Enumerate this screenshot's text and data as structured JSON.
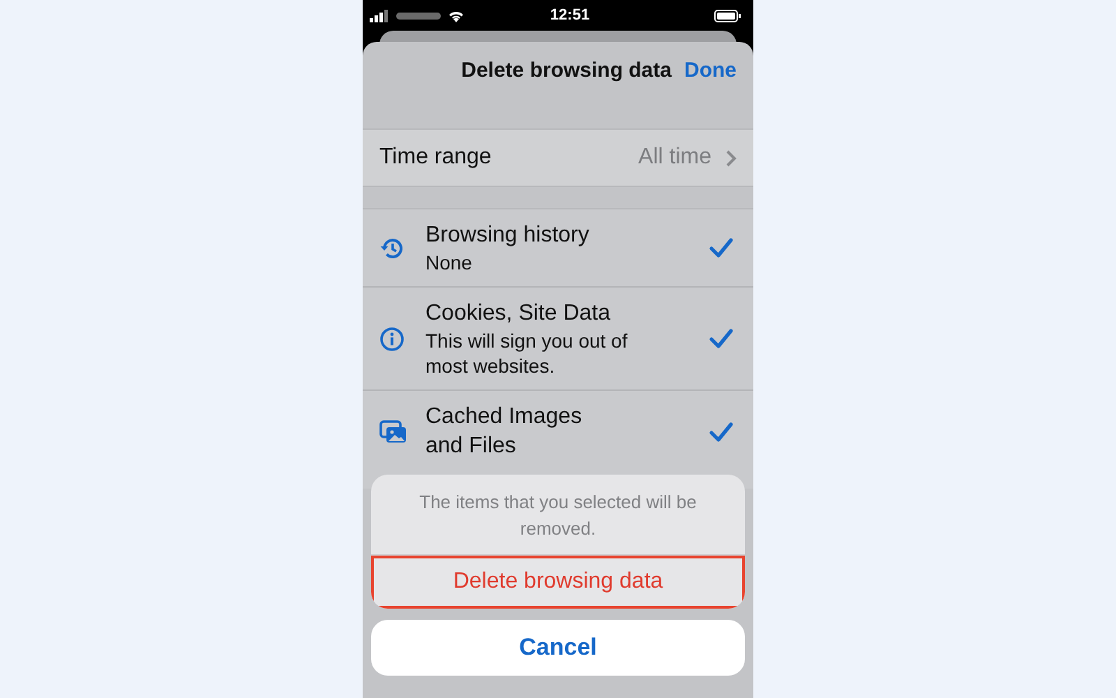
{
  "status_bar": {
    "time": "12:51"
  },
  "header": {
    "title": "Delete browsing data",
    "done": "Done"
  },
  "time_range": {
    "label": "Time range",
    "value": "All time"
  },
  "items": [
    {
      "kind": "history",
      "title": "Browsing history",
      "detail": "None",
      "checked": true
    },
    {
      "kind": "info",
      "title": "Cookies, Site Data",
      "detail": "This will sign you out of most websites.",
      "checked": true
    },
    {
      "kind": "images",
      "title": "Cached Images and Files",
      "checked": true
    }
  ],
  "action_sheet": {
    "message": "The items that you selected will be removed.",
    "actions": [
      {
        "label": "Delete browsing data",
        "kind": "destructive",
        "highlighted": true
      }
    ],
    "cancel": "Cancel"
  }
}
